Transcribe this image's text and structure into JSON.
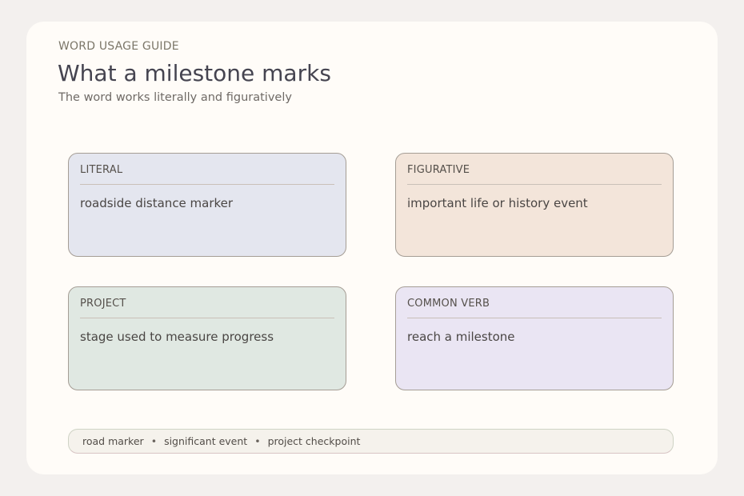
{
  "header": {
    "eyebrow": "WORD USAGE GUIDE",
    "title": "What a milestone marks",
    "subtitle": "The word works literally and figuratively"
  },
  "panels": [
    {
      "label": "LITERAL",
      "text": "roadside distance marker",
      "color": "#e4e6ef"
    },
    {
      "label": "FIGURATIVE",
      "text": "important life or history event",
      "color": "#f3e5da"
    },
    {
      "label": "PROJECT",
      "text": "stage used to measure progress",
      "color": "#e0e8e2"
    },
    {
      "label": "COMMON VERB",
      "text": "reach a milestone",
      "color": "#eae5f3"
    }
  ],
  "footer": {
    "items": [
      "road marker",
      "significant event",
      "project checkpoint"
    ],
    "separator": "•"
  }
}
